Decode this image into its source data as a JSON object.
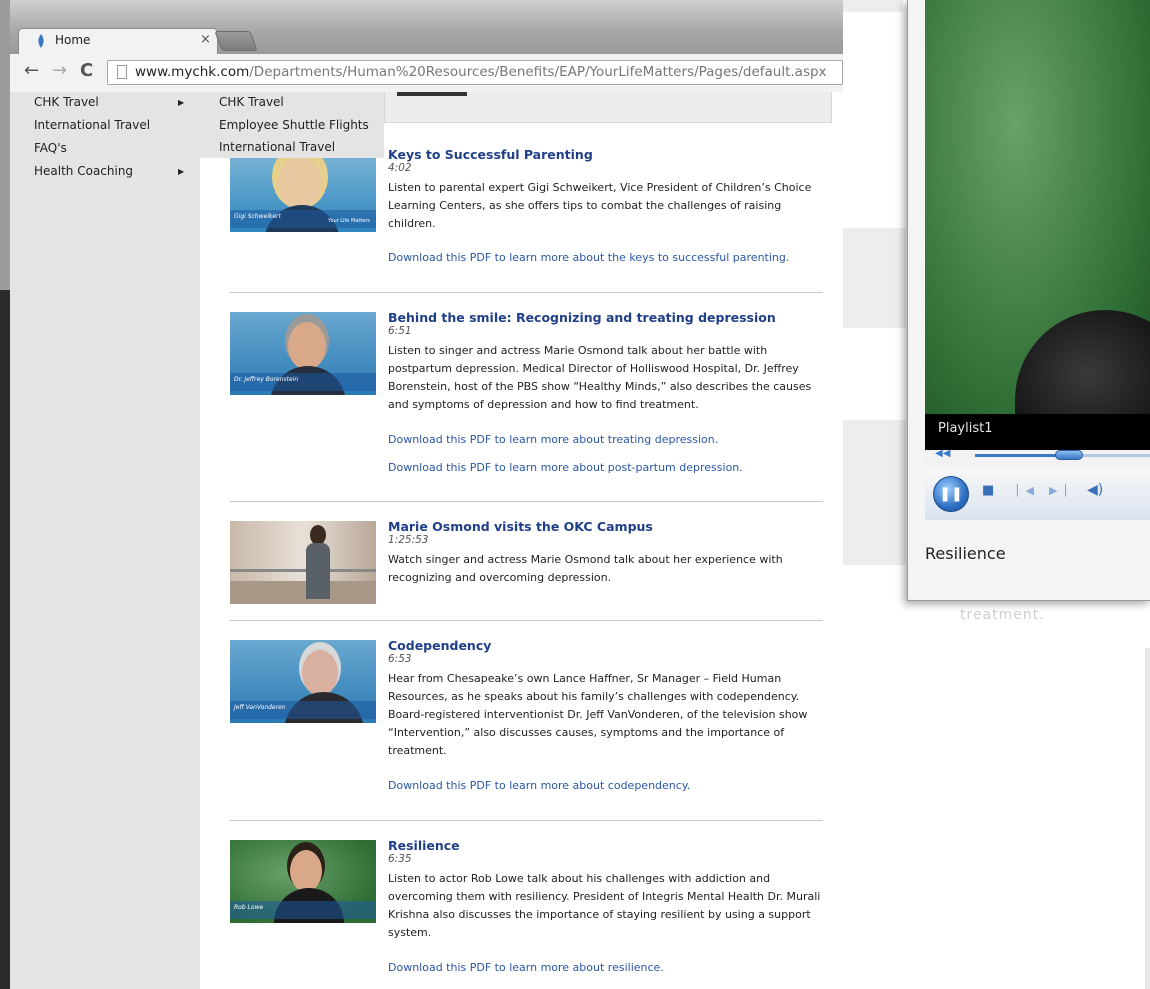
{
  "browser": {
    "tab_title": "Home",
    "tab_close": "×",
    "url_host": "www.mychk.com",
    "url_path": "/Departments/Human%20Resources/Benefits/EAP/YourLifeMatters/Pages/default.aspx"
  },
  "sidenav": {
    "items": [
      {
        "label": "CHK Travel",
        "arrow": "▶"
      },
      {
        "label": "International Travel"
      },
      {
        "label": "FAQ's"
      },
      {
        "label": "Health Coaching",
        "arrow": "▶"
      }
    ],
    "flyout": [
      "CHK Travel",
      "Employee Shuttle Flights",
      "International Travel"
    ]
  },
  "videos": [
    {
      "title": "Keys to Successful Parenting",
      "duration": "4:02",
      "description": "Listen to parental expert Gigi Schweikert, Vice President of Children’s Choice Learning Centers, as she offers tips to combat the challenges of raising children.",
      "links": [
        "Download this PDF to learn more about the keys to successful parenting."
      ],
      "thumb_caption": "Gigi Schweikert"
    },
    {
      "title": "Behind the smile: Recognizing and treating depression",
      "duration": "6:51",
      "description": "Listen to singer and actress Marie Osmond talk about her battle with postpartum depression. Medical Director of Holliswood Hospital, Dr. Jeffrey Borenstein, host of the PBS show “Healthy Minds,” also describes the causes and symptoms of depression and how to find treatment.",
      "links": [
        "Download this PDF to learn more about treating depression.",
        "Download this PDF to learn more about post-partum depression."
      ],
      "thumb_caption": "Dr. Jeffrey Borenstein"
    },
    {
      "title": "Marie Osmond visits the OKC Campus",
      "duration": "1:25:53",
      "description": "Watch singer and actress Marie Osmond talk about her experience with recognizing and overcoming depression.",
      "links": []
    },
    {
      "title": "Codependency",
      "duration": "6:53",
      "description": "Hear from Chesapeake’s own Lance Haffner, Sr Manager – Field Human Resources, as he speaks about his family’s challenges with codependency. Board-registered interventionist Dr. Jeff VanVonderen, of the television show “Intervention,” also discusses causes, symptoms and the importance of treatment.",
      "links": [
        "Download this PDF to learn more about codependency."
      ],
      "thumb_caption": "Jeff VanVonderen"
    },
    {
      "title": "Resilience",
      "duration": "6:35",
      "description": "Listen to actor Rob Lowe talk about his challenges with addiction and overcoming them with resiliency. President of Integris Mental Health Dr. Murali Krishna also discusses the importance of staying resilient by using a support system.",
      "links": [
        "Download this PDF to learn more about resilience."
      ],
      "thumb_caption": "Rob Lowe"
    }
  ],
  "player": {
    "playlist": "Playlist1",
    "now_playing": "Resilience",
    "below_text": "treatment."
  },
  "colors": {
    "link": "#2a58a6",
    "title": "#1f3f88",
    "nav_bg": "#e4e4e4"
  }
}
